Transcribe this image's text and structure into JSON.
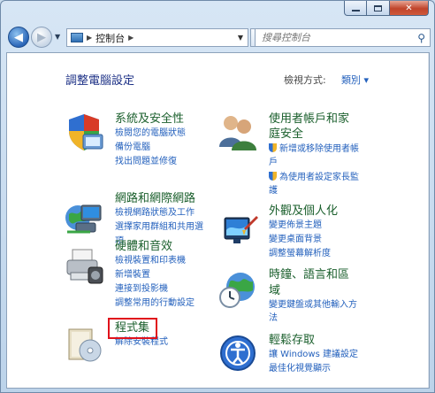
{
  "window": {
    "minimize_icon": "minimize-icon",
    "maximize_icon": "maximize-icon",
    "close_icon": "close-icon",
    "close_glyph": "✕"
  },
  "nav": {
    "back_glyph": "◀",
    "forward_glyph": "▶",
    "address_segments": [
      "控制台"
    ],
    "refresh_glyph": "↻",
    "search_placeholder": "搜尋控制台",
    "search_glyph": "⚲"
  },
  "header": {
    "title": "調整電腦設定",
    "view_by_label": "檢視方式:",
    "view_by_value": "類別 ▾"
  },
  "categories": {
    "system": {
      "title": "系統及安全性",
      "links": [
        "檢閱您的電腦狀態",
        "備份電腦",
        "找出問題並修復"
      ]
    },
    "network": {
      "title": "網路和網際網路",
      "links": [
        "檢視網路狀態及工作",
        "選擇家用群組和共用選",
        "項"
      ]
    },
    "hardware": {
      "title": "硬體和音效",
      "links": [
        "檢視裝置和印表機",
        "新增裝置",
        "連接到投影機",
        "調整常用的行動設定"
      ]
    },
    "programs": {
      "title": "程式集",
      "links": [
        "解除安裝程式"
      ]
    },
    "users": {
      "title_line1": "使用者帳戶和家",
      "title_line2": "庭安全",
      "links": [
        "新增或移除使用者帳",
        "戶",
        "為使用者設定家長監",
        "護"
      ]
    },
    "appearance": {
      "title": "外觀及個人化",
      "links": [
        "變更佈景主題",
        "變更桌面背景",
        "調整螢幕解析度"
      ]
    },
    "clock": {
      "title_line1": "時鐘、語言和區",
      "title_line2": "域",
      "links": [
        "變更鍵盤或其他輸入方",
        "法"
      ]
    },
    "ease": {
      "title": "輕鬆存取",
      "links": [
        "讓 Windows 建議設定",
        "最佳化視覺顯示"
      ]
    }
  },
  "colors": {
    "category_title": "#1a5f2c",
    "link": "#2461bd",
    "heading": "#1e3287",
    "highlight_box": "#e0121b"
  }
}
